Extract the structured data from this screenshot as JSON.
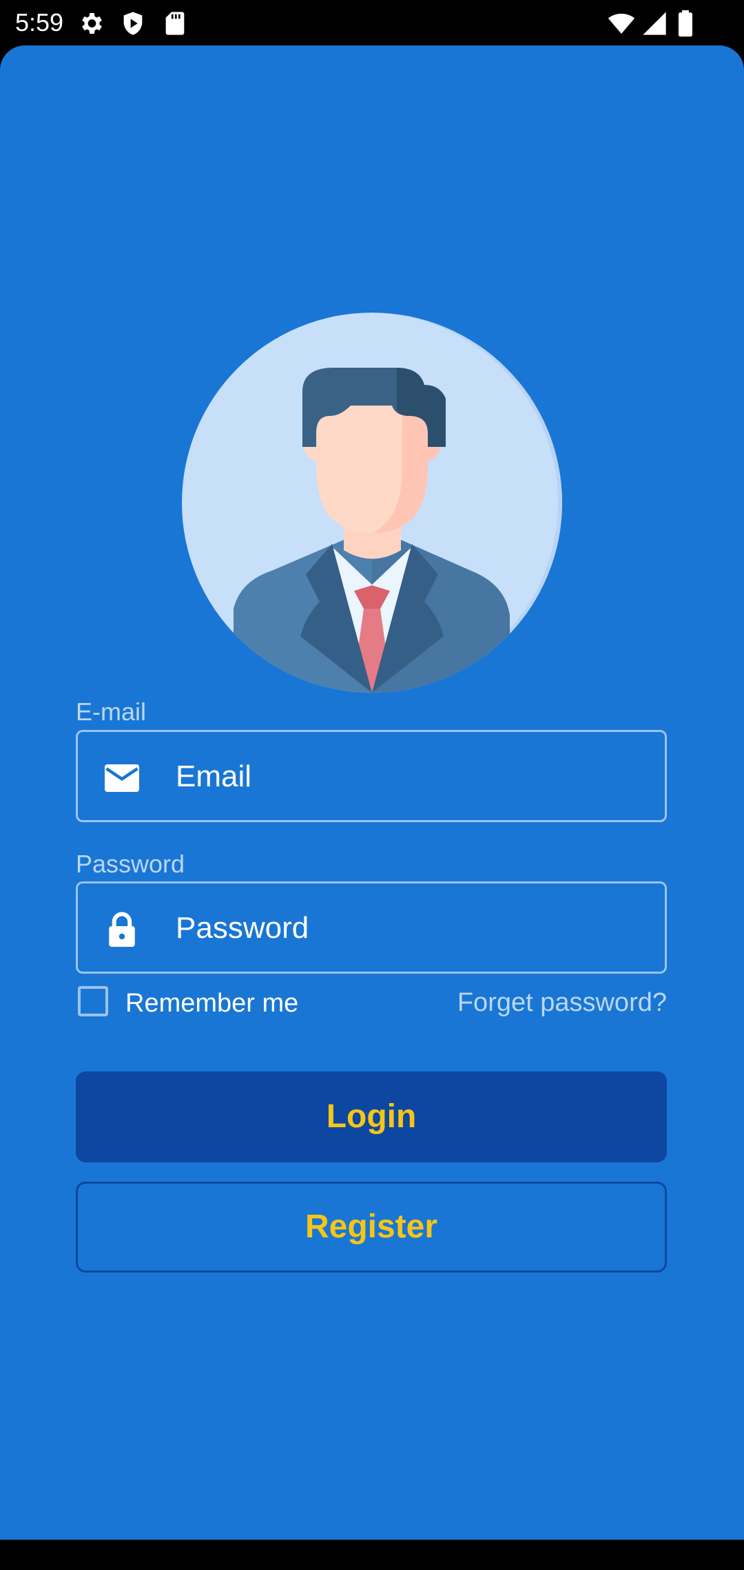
{
  "status_bar": {
    "time": "5:59",
    "left_icons": [
      "gear-icon",
      "shield-play-icon",
      "sd-card-icon"
    ],
    "right_icons": [
      "wifi-icon",
      "signal-icon",
      "battery-icon"
    ]
  },
  "colors": {
    "background": "#1976D4",
    "button_primary": "#0D47A1",
    "button_text": "#F5C518",
    "label": "#BBD6F5"
  },
  "avatar": {
    "icon": "businessman-avatar-icon"
  },
  "email": {
    "label": "E-mail",
    "placeholder": "Email",
    "icon": "mail-icon"
  },
  "password": {
    "label": "Password",
    "placeholder": "Password",
    "icon": "lock-icon"
  },
  "remember": {
    "label": "Remember me",
    "checked": false
  },
  "forgot": {
    "label": "Forget password?"
  },
  "buttons": {
    "login": "Login",
    "register": "Register"
  }
}
